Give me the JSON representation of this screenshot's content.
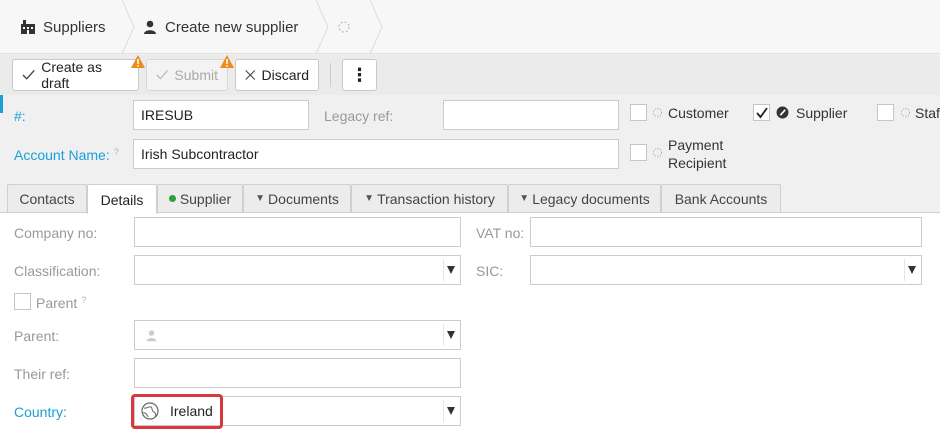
{
  "breadcrumb": {
    "items": [
      {
        "label": "Suppliers",
        "icon": "building-icon"
      },
      {
        "label": "Create new supplier",
        "icon": "person-icon"
      },
      {
        "label": "",
        "icon": "spinner-icon"
      }
    ]
  },
  "toolbar": {
    "create_draft_label": "Create as draft",
    "submit_label": "Submit",
    "discard_label": "Discard",
    "more_label": "⋮"
  },
  "form": {
    "number_label": "#:",
    "number_value": "IRESUB",
    "legacy_ref_label": "Legacy ref:",
    "legacy_ref_value": "",
    "account_name_label": "Account Name:",
    "account_name_help": "?",
    "account_name_value": "Irish Subcontractor",
    "roles": [
      {
        "label": "Customer",
        "checked": false
      },
      {
        "label": "Supplier",
        "checked": true
      },
      {
        "label": "Staf",
        "checked": false
      }
    ],
    "payment_recipient_line1": "Payment",
    "payment_recipient_line2": "Recipient"
  },
  "tabs": [
    {
      "label": "Contacts",
      "active": false
    },
    {
      "label": "Details",
      "active": true
    },
    {
      "label": "Supplier",
      "active": false,
      "dot_color": "#2e9e3e"
    },
    {
      "label": "Documents",
      "active": false
    },
    {
      "label": "Transaction history",
      "active": false
    },
    {
      "label": "Legacy documents",
      "active": false
    },
    {
      "label": "Bank Accounts",
      "active": false
    }
  ],
  "details": {
    "company_no_label": "Company no:",
    "company_no_value": "",
    "vat_no_label": "VAT no:",
    "vat_no_value": "",
    "classification_label": "Classification:",
    "classification_value": "",
    "sic_label": "SIC:",
    "sic_value": "",
    "parent_check_label": "Parent",
    "parent_help": "?",
    "parent_label": "Parent:",
    "parent_value": "",
    "their_ref_label": "Their ref:",
    "their_ref_value": "",
    "country_label": "Country:",
    "country_value": "Ireland"
  },
  "colors": {
    "accent": "#1a9fd9",
    "warning": "#f08a1c",
    "highlight": "#d9363e"
  }
}
